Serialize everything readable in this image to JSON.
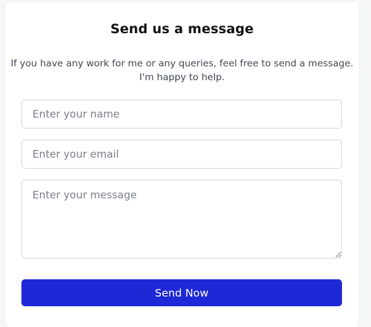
{
  "form": {
    "title": "Send us a message",
    "description_line1": "If you have any work for me or any queries, feel free to send a message.",
    "description_line2": "I'm happy to help.",
    "name_placeholder": "Enter your name",
    "email_placeholder": "Enter your email",
    "message_placeholder": "Enter your message",
    "submit_label": "Send Now"
  },
  "colors": {
    "accent": "#1f28d6",
    "background": "#f6f7f9",
    "card": "#ffffff"
  }
}
